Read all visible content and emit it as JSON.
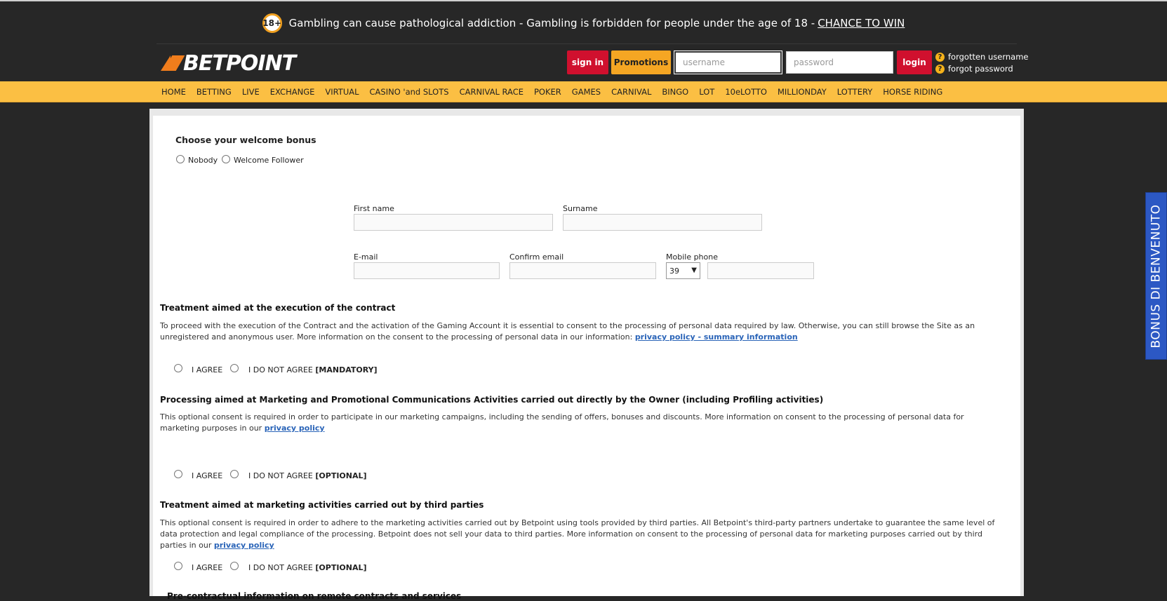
{
  "warning": {
    "badge": "18+",
    "text": "Gambling can cause pathological addiction - Gambling is forbidden for people under the age of 18 -",
    "link": "CHANCE TO WIN"
  },
  "header": {
    "logo": "BETPOINT",
    "signin": "sign in",
    "promotions": "Promotions",
    "username_placeholder": "username",
    "password_placeholder": "password",
    "login": "login",
    "forgot_username": "forgotten username",
    "forgot_password": "forgot password"
  },
  "nav": [
    "HOME",
    "BETTING",
    "LIVE",
    "EXCHANGE",
    "VIRTUAL",
    "CASINO 'and SLOTS",
    "CARNIVAL RACE",
    "POKER",
    "GAMES",
    "CARNIVAL",
    "BINGO",
    "LOT",
    "10eLOTTO",
    "MILLIONDAY",
    "LOTTERY",
    "HORSE RIDING"
  ],
  "bonus": {
    "title": "Choose your welcome bonus",
    "opt1": "Nobody",
    "opt2": "Welcome Follower"
  },
  "form": {
    "first_name": "First name",
    "surname": "Surname",
    "email": "E-mail",
    "confirm_email": "Confirm email",
    "mobile": "Mobile phone",
    "prefix": "39"
  },
  "sections": {
    "s1": {
      "title": "Treatment aimed at the execution of the contract",
      "text": "To proceed with the execution of the Contract and the activation of the Gaming Account it is essential to consent to the processing of personal data required by law. Otherwise, you can still browse the Site as an unregistered and anonymous user. More information on the consent to the processing of personal data in our information:",
      "link": "privacy policy - summary information",
      "tag": "[MANDATORY]"
    },
    "s2": {
      "title": "Processing aimed at Marketing and Promotional Communications Activities carried out directly by the Owner (including Profiling activities)",
      "text": "This optional consent is required in order to participate in our marketing campaigns, including the sending of offers, bonuses and discounts. More information on consent to the processing of personal data for marketing purposes in our",
      "link": "privacy policy",
      "tag": "[OPTIONAL]"
    },
    "s3": {
      "title": "Treatment aimed at marketing activities carried out by third parties",
      "text": "This optional consent is required in order to adhere to the marketing activities carried out by Betpoint using tools provided by third parties. All Betpoint's third-party partners undertake to guarantee the same level of data protection and legal compliance of the processing. Betpoint does not sell your data to third parties. More information on consent to the processing of personal data for marketing purposes carried out by third parties in our",
      "link": "privacy policy",
      "tag": "[OPTIONAL]"
    },
    "agree": "I AGREE",
    "disagree": "I DO NOT AGREE",
    "next_title": "Pre-contractual information on remote contracts and services"
  },
  "side_tab": "BONUS DI BENVENUTO"
}
